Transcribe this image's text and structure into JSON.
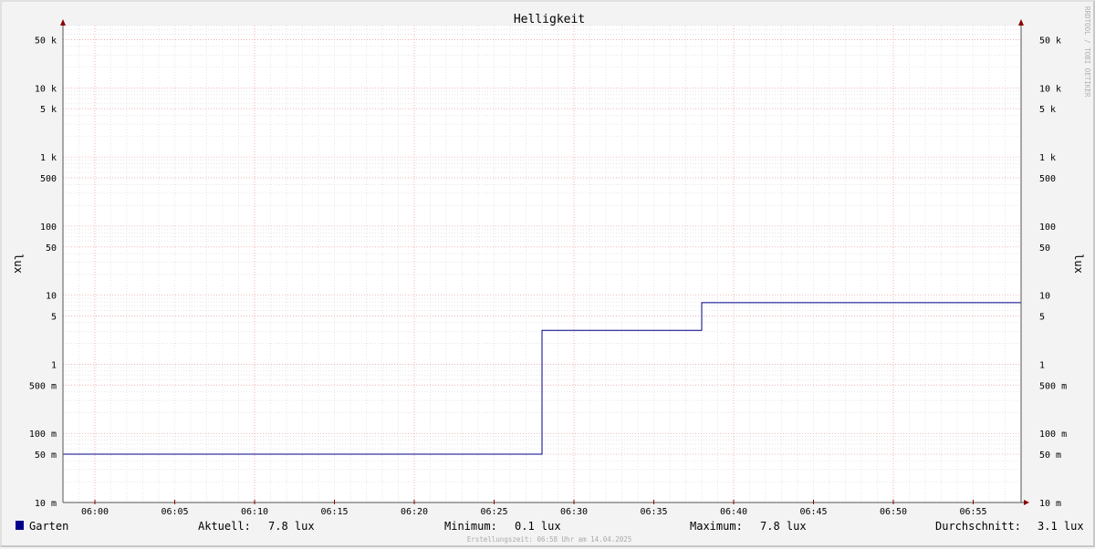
{
  "chart_data": {
    "type": "line",
    "title": "Helligkeit",
    "ylabel": "lux",
    "yscale": "log",
    "ylim": [
      0.01,
      80000
    ],
    "x_range": [
      "05:58",
      "06:58"
    ],
    "x_ticks": [
      "06:00",
      "06:05",
      "06:10",
      "06:15",
      "06:20",
      "06:25",
      "06:30",
      "06:35",
      "06:40",
      "06:45",
      "06:50",
      "06:55"
    ],
    "y_ticks": [
      {
        "value": 0.01,
        "label": "10 m"
      },
      {
        "value": 0.05,
        "label": "50 m"
      },
      {
        "value": 0.1,
        "label": "100 m"
      },
      {
        "value": 0.5,
        "label": "500 m"
      },
      {
        "value": 1,
        "label": "1"
      },
      {
        "value": 5,
        "label": "5"
      },
      {
        "value": 10,
        "label": "10"
      },
      {
        "value": 50,
        "label": "50"
      },
      {
        "value": 100,
        "label": "100"
      },
      {
        "value": 500,
        "label": "500"
      },
      {
        "value": 1000,
        "label": "1 k"
      },
      {
        "value": 5000,
        "label": "5 k"
      },
      {
        "value": 10000,
        "label": "10 k"
      },
      {
        "value": 50000,
        "label": "50 k"
      }
    ],
    "grid": true,
    "series": [
      {
        "name": "Garten",
        "color": "#00008b",
        "points": [
          {
            "x": "05:58",
            "y": 0.05
          },
          {
            "x": "06:28",
            "y": 0.05
          },
          {
            "x": "06:28",
            "y": 3.1
          },
          {
            "x": "06:38",
            "y": 3.1
          },
          {
            "x": "06:38",
            "y": 7.8
          },
          {
            "x": "06:58",
            "y": 7.8
          }
        ]
      }
    ],
    "legend": {
      "series_name": "Garten",
      "swatch_color": "#00008b",
      "current_label": "Aktuell:",
      "current_value": "7.8 lux",
      "min_label": "Minimum:",
      "min_value": "0.1 lux",
      "max_label": "Maximum:",
      "max_value": "7.8 lux",
      "avg_label": "Durchschnitt:",
      "avg_value": "3.1 lux"
    },
    "watermark": "RRDTOOL / TOBI OETIKER",
    "footer": "Erstellungszeit: 06:58 Uhr am 14.04.2025"
  }
}
